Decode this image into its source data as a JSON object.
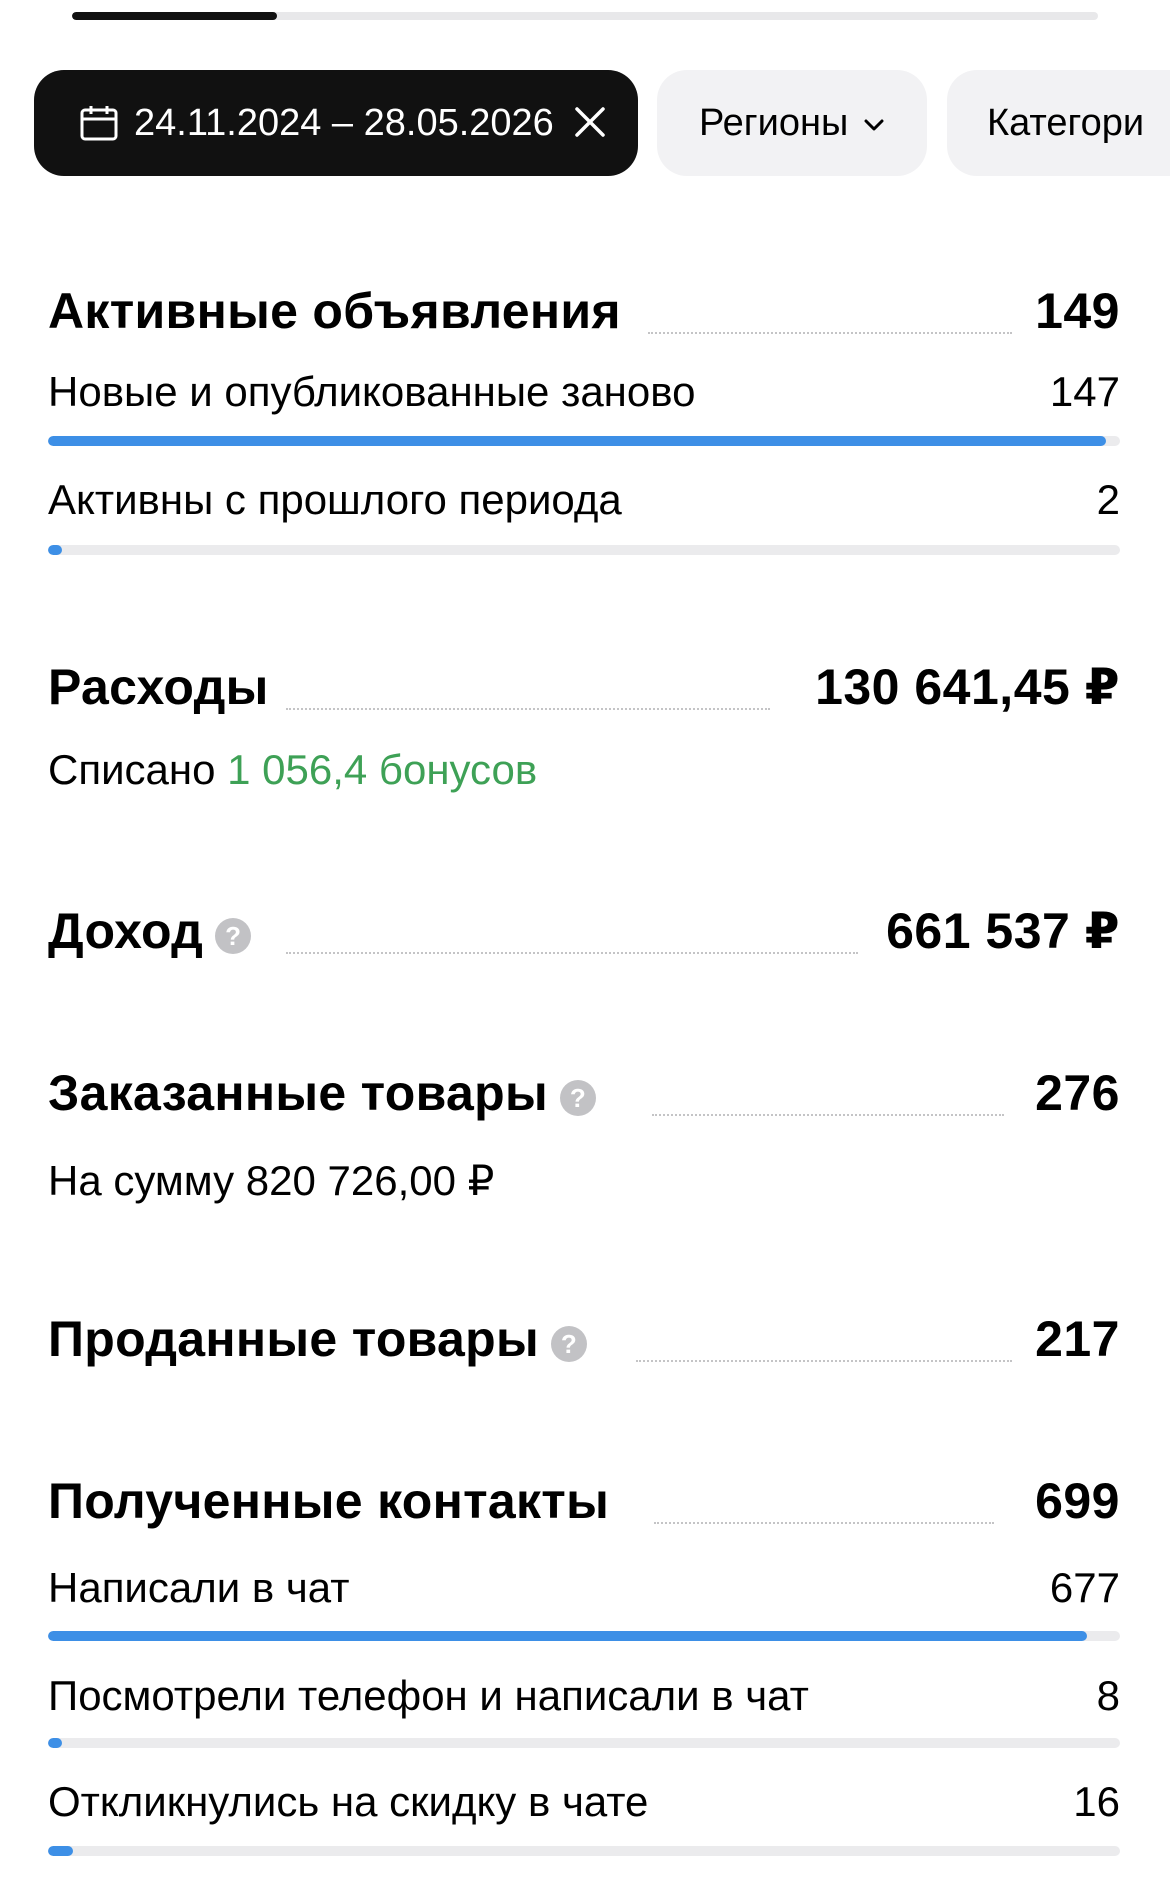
{
  "top_tab_progress": 0.2,
  "colors": {
    "accent_blue": "#3d8fe6",
    "bonus_green": "#3ea156",
    "chip_dark": "#111111",
    "chip_light": "#f2f2f4"
  },
  "filters": {
    "date_range": "24.11.2024 – 28.05.2026",
    "date_icon": "calendar-icon",
    "clear_icon": "close-icon",
    "regions_label": "Регионы",
    "regions_icon": "chevron-down-icon",
    "categories_label": "Категори"
  },
  "active_ads": {
    "title": "Активные объявления",
    "value": "149",
    "items": [
      {
        "label": "Новые и опубликованные заново",
        "value": "147",
        "share": 0.987
      },
      {
        "label": "Активны с прошлого периода",
        "value": "2",
        "share": 0.013
      }
    ]
  },
  "expenses": {
    "title": "Расходы",
    "value": "130 641,45 ₽",
    "written_off_prefix": "Списано",
    "written_off_bonus": "1 056,4 бонусов"
  },
  "income": {
    "title": "Доход",
    "value": "661 537 ₽",
    "help_icon": "question-circle-icon"
  },
  "ordered": {
    "title": "Заказанные товары",
    "value": "276",
    "sum_text": "На сумму 820 726,00 ₽",
    "help_icon": "question-circle-icon"
  },
  "sold": {
    "title": "Проданные товары",
    "value": "217",
    "help_icon": "question-circle-icon"
  },
  "contacts": {
    "title": "Полученные контакты",
    "value": "699",
    "items": [
      {
        "label": "Написали в чат",
        "value": "677",
        "share": 0.969
      },
      {
        "label": "Посмотрели телефон и написали в чат",
        "value": "8",
        "share": 0.011
      },
      {
        "label": "Откликнулись на скидку в чате",
        "value": "16",
        "share": 0.023
      }
    ]
  }
}
